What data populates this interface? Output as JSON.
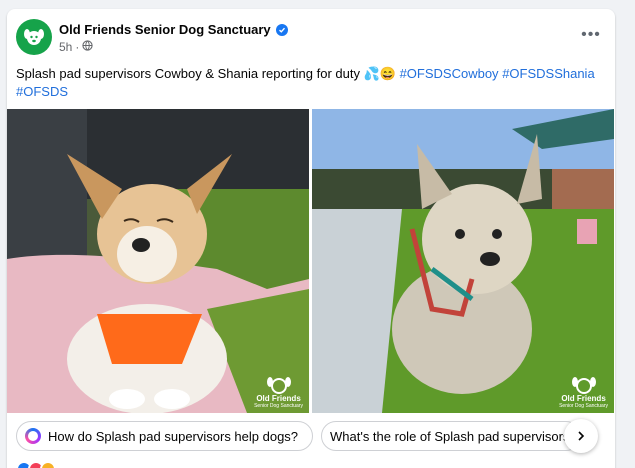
{
  "post": {
    "page_name": "Old Friends Senior Dog Sanctuary",
    "timestamp": "5h",
    "separator": "·",
    "text": "Splash pad supervisors Cowboy & Shania reporting for duty 💦😄",
    "hashtags": [
      "#OFSDSCowboy",
      "#OFSDSShania",
      "#OFSDS"
    ]
  },
  "photos": [
    {
      "subject": "Cowboy chihuahua on pink blanket",
      "watermark_title": "Old Friends",
      "watermark_sub": "Senior Dog Sanctuary"
    },
    {
      "subject": "Shania terrier on splash pad",
      "watermark_title": "Old Friends",
      "watermark_sub": "Senior Dog Sanctuary"
    }
  ],
  "suggestions": [
    "How do Splash pad supervisors help dogs?",
    "What's the role of Splash pad supervisors?"
  ],
  "icons": {
    "verified": "verified-badge-icon",
    "privacy": "globe-icon",
    "more": "more-options-icon",
    "next": "chevron-right-icon"
  },
  "colors": {
    "brand_green": "#16a34a",
    "link_blue": "#216fdb",
    "verified_blue": "#1877f2"
  }
}
